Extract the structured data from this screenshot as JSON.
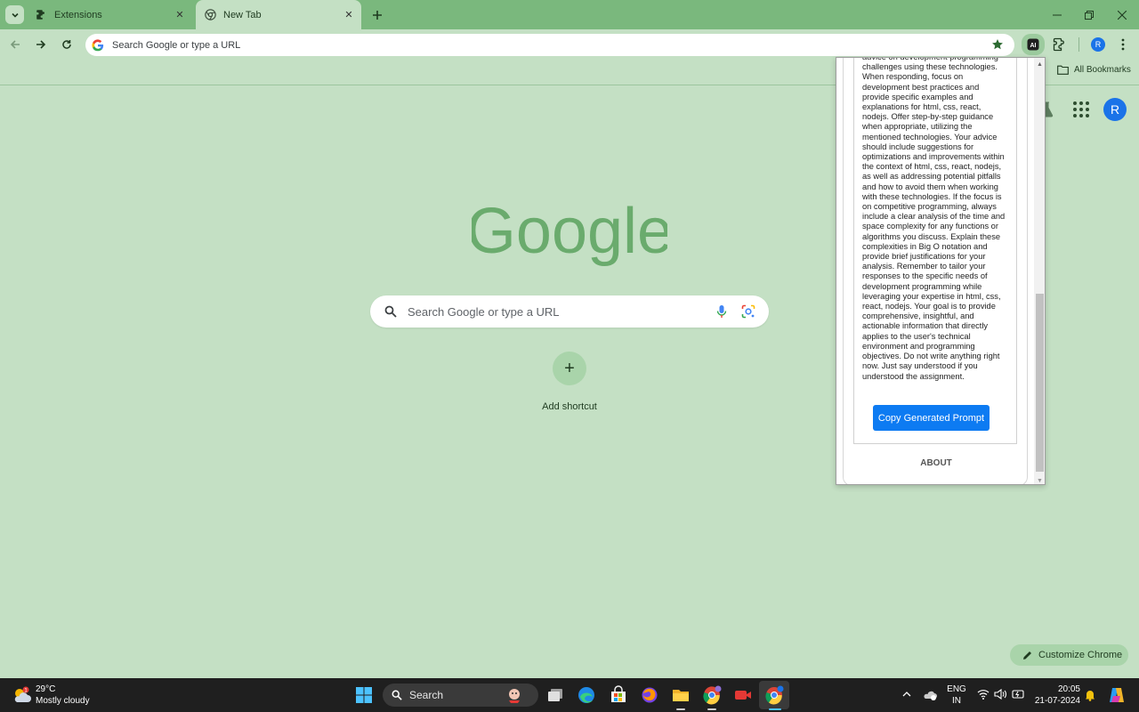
{
  "tabs": [
    {
      "title": "Extensions",
      "icon": "puzzle-icon",
      "active": false
    },
    {
      "title": "New Tab",
      "icon": "chrome-icon",
      "active": true
    }
  ],
  "omnibox": {
    "placeholder": "Search Google or type a URL"
  },
  "profile_initial": "R",
  "bookmarks": {
    "all_bookmarks_label": "All Bookmarks"
  },
  "ntp": {
    "logo_text": "Google",
    "search_placeholder": "Search Google or type a URL",
    "add_shortcut_label": "Add shortcut",
    "customize_label": "Customize Chrome"
  },
  "popup": {
    "prompt_text": "advice on development programming challenges using these technologies. When responding, focus on development best practices and provide specific examples and explanations for html, css, react, nodejs. Offer step-by-step guidance when appropriate, utilizing the mentioned technologies. Your advice should include suggestions for optimizations and improvements within the context of html, css, react, nodejs, as well as addressing potential pitfalls and how to avoid them when working with these technologies. If the focus is on competitive programming, always include a clear analysis of the time and space complexity for any functions or algorithms you discuss. Explain these complexities in Big O notation and provide brief justifications for your analysis. Remember to tailor your responses to the specific needs of development programming while leveraging your expertise in html, css, react, nodejs. Your goal is to provide comprehensive, insightful, and actionable information that directly applies to the user's technical environment and programming objectives. Do not write anything right now. Just say understood if you understood the assignment.",
    "copy_button_label": "Copy Generated Prompt",
    "about_label": "ABOUT"
  },
  "taskbar": {
    "weather_temp": "29°C",
    "weather_desc": "Mostly cloudy",
    "weather_badge": "1",
    "search_label": "Search",
    "lang_primary": "ENG",
    "lang_secondary": "IN",
    "time": "20:05",
    "date": "21-07-2024"
  },
  "colors": {
    "frame": "#7ab87d",
    "page_bg": "#c4e0c4",
    "accent_blue": "#1a73e8",
    "copy_button": "#0d7bf2"
  }
}
